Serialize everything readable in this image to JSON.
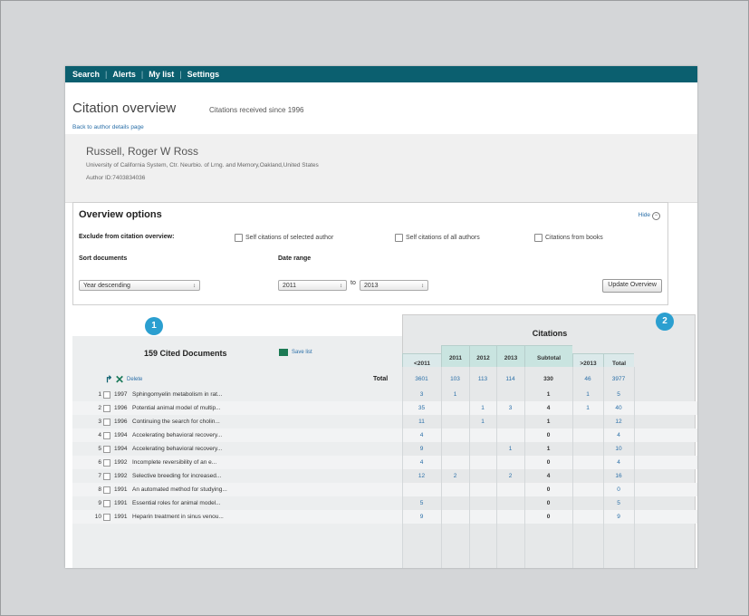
{
  "nav": {
    "items": [
      "Search",
      "Alerts",
      "My list",
      "Settings"
    ]
  },
  "header": {
    "title": "Citation overview",
    "subtitle": "Citations received since 1996",
    "back_link": "Back to author details page"
  },
  "author": {
    "name": "Russell, Roger W Ross",
    "affiliation": "University of California System, Ctr. Neurbio. of Lrng. and Memory,Oakland,United States",
    "author_id": "Author ID:7403834036"
  },
  "options": {
    "title": "Overview options",
    "hide_label": "Hide",
    "exclude_label": "Exclude from citation overview:",
    "checks": [
      "Self citations of selected author",
      "Self citations of all authors",
      "Citations from books"
    ],
    "sort_label": "Sort documents",
    "sort_value": "Year descending",
    "date_label": "Date range",
    "date_from": "2011",
    "to_label": "to",
    "date_to": "2013",
    "update_label": "Update Overview"
  },
  "markers": {
    "one": "1",
    "two": "2"
  },
  "citations_label": "Citations",
  "docs": {
    "title": "159 Cited Documents",
    "save_label": "Save list",
    "delete_label": "Delete",
    "total_label": "Total"
  },
  "columns": [
    "<2011",
    "2011",
    "2012",
    "2013",
    "Subtotal",
    ">2013",
    "Total"
  ],
  "totals": [
    "3601",
    "103",
    "113",
    "114",
    "330",
    "46",
    "3977"
  ],
  "rows": [
    {
      "num": "1",
      "year": "1997",
      "title": "Sphingomyelin metabolism in rat...",
      "c": [
        "3",
        "1",
        "",
        "",
        "1",
        "1",
        "5"
      ]
    },
    {
      "num": "2",
      "year": "1996",
      "title": "Potential animal model of multip...",
      "c": [
        "35",
        "",
        "1",
        "3",
        "4",
        "1",
        "40"
      ]
    },
    {
      "num": "3",
      "year": "1996",
      "title": "Continuing the search for cholin...",
      "c": [
        "11",
        "",
        "1",
        "",
        "1",
        "",
        "12"
      ]
    },
    {
      "num": "4",
      "year": "1994",
      "title": "Accelerating behavioral recovery...",
      "c": [
        "4",
        "",
        "",
        "",
        "0",
        "",
        "4"
      ]
    },
    {
      "num": "5",
      "year": "1994",
      "title": "Accelerating behavioral recovery...",
      "c": [
        "9",
        "",
        "",
        "1",
        "1",
        "",
        "10"
      ]
    },
    {
      "num": "6",
      "year": "1992",
      "title": "Incomplete reversibility of an e...",
      "c": [
        "4",
        "",
        "",
        "",
        "0",
        "",
        "4"
      ]
    },
    {
      "num": "7",
      "year": "1992",
      "title": "Selective breeding for increased...",
      "c": [
        "12",
        "2",
        "",
        "2",
        "4",
        "",
        "16"
      ]
    },
    {
      "num": "8",
      "year": "1991",
      "title": "An automated method for studying...",
      "c": [
        "",
        "",
        "",
        "",
        "0",
        "",
        "0"
      ]
    },
    {
      "num": "9",
      "year": "1991",
      "title": "Essential roles for animal model...",
      "c": [
        "5",
        "",
        "",
        "",
        "0",
        "",
        "5"
      ]
    },
    {
      "num": "10",
      "year": "1991",
      "title": "Heparin treatment in sinus venou...",
      "c": [
        "9",
        "",
        "",
        "",
        "0",
        "",
        "9"
      ]
    }
  ]
}
